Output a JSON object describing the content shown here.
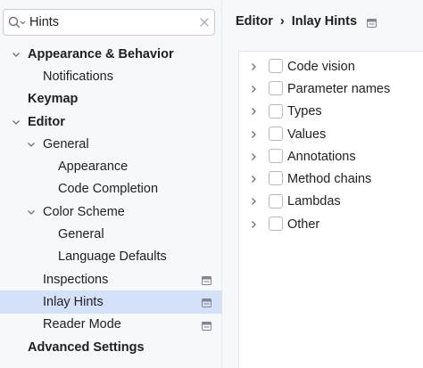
{
  "search": {
    "value": "Hints",
    "placeholder": ""
  },
  "tree": {
    "items": [
      {
        "label": "Appearance & Behavior"
      },
      {
        "label": "Notifications"
      },
      {
        "label": "Keymap"
      },
      {
        "label": "Editor"
      },
      {
        "label": "General"
      },
      {
        "label": "Appearance"
      },
      {
        "label": "Code Completion"
      },
      {
        "label": "Color Scheme"
      },
      {
        "label": "General"
      },
      {
        "label": "Language Defaults"
      },
      {
        "label": "Inspections"
      },
      {
        "label": "Inlay Hints"
      },
      {
        "label": "Reader Mode"
      },
      {
        "label": "Advanced Settings"
      }
    ]
  },
  "breadcrumb": {
    "parent": "Editor",
    "separator": "›",
    "current": "Inlay Hints"
  },
  "hints": {
    "items": [
      {
        "label": "Code vision",
        "checked": false
      },
      {
        "label": "Parameter names",
        "checked": false
      },
      {
        "label": "Types",
        "checked": false
      },
      {
        "label": "Values",
        "checked": false
      },
      {
        "label": "Annotations",
        "checked": false
      },
      {
        "label": "Method chains",
        "checked": false
      },
      {
        "label": "Lambdas",
        "checked": false
      },
      {
        "label": "Other",
        "checked": false
      }
    ]
  },
  "colors": {
    "selection": "#d5e1f9",
    "background": "#f7f8fa",
    "panel": "#ffffff",
    "text": "#1e1f22"
  }
}
